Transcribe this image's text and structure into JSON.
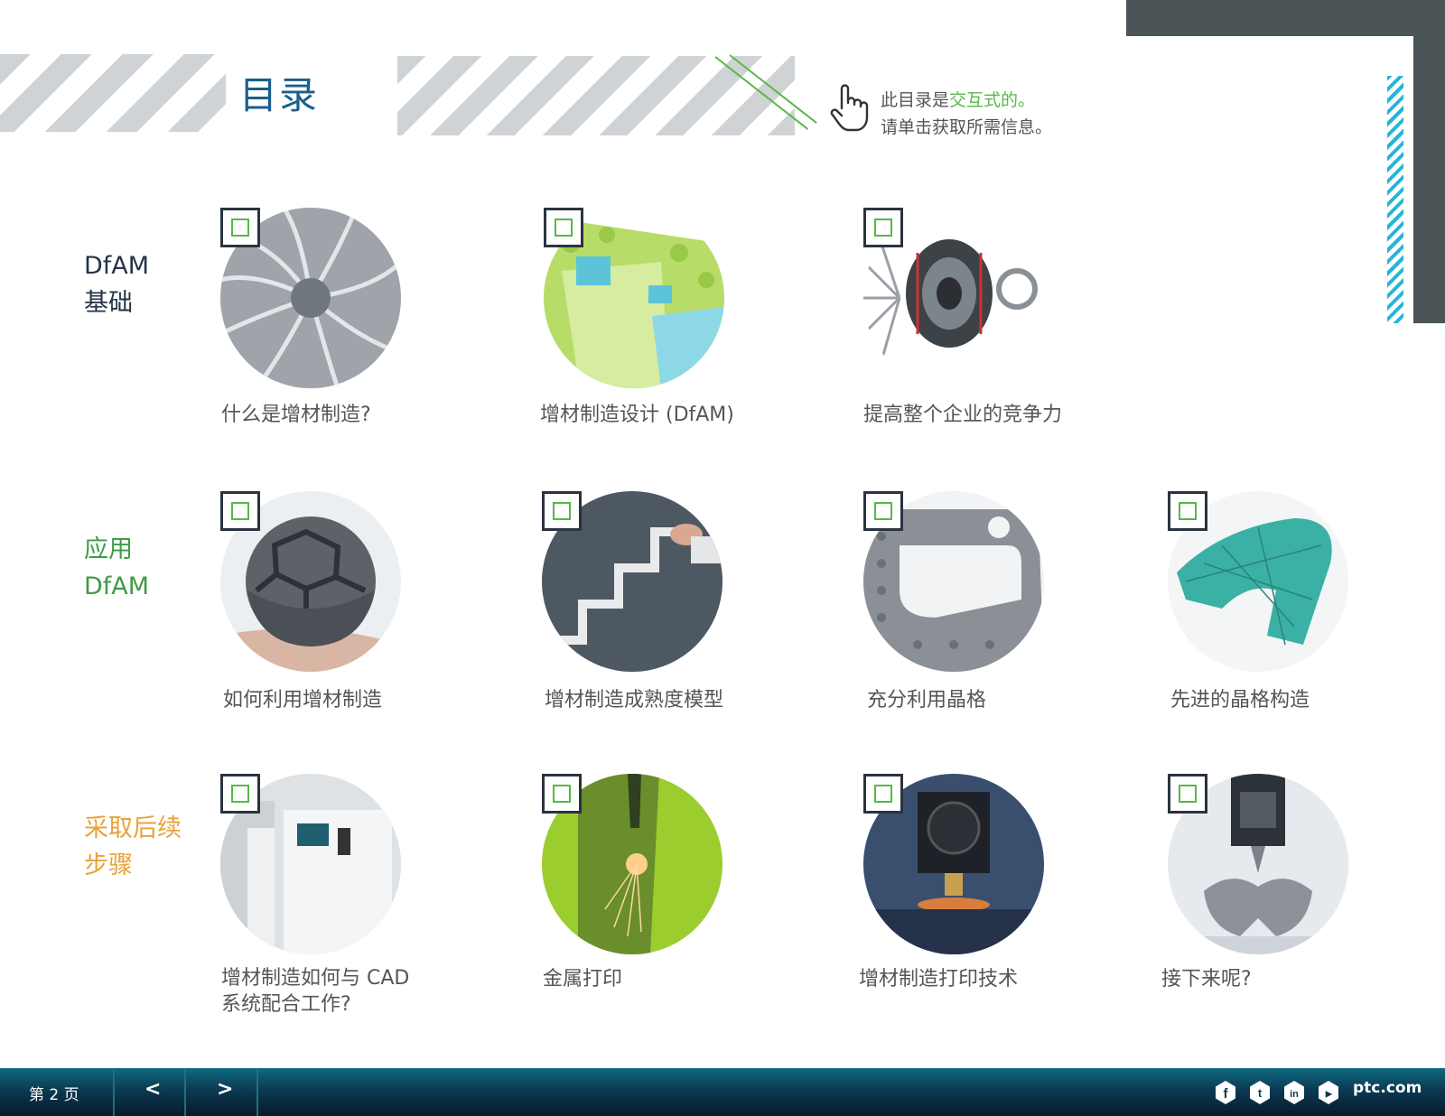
{
  "header": {
    "title": "目录",
    "hint_line1_prefix": "此目录是",
    "hint_line1_highlight": "交互式的。",
    "hint_line2": "请单击获取所需信息。",
    "hand_icon": "pointer-hand-icon"
  },
  "sections": [
    {
      "line1": "DfAM",
      "line2": "基础"
    },
    {
      "line1": "应用",
      "line2": "DfAM"
    },
    {
      "line1": "采取后续",
      "line2": "步骤"
    }
  ],
  "tiles": [
    {
      "caption": "什么是增材制造?"
    },
    {
      "caption": "增材制造设计 (DfAM)"
    },
    {
      "caption": "提高整个企业的竞争力"
    },
    {
      "caption": "如何利用增材制造"
    },
    {
      "caption": "增材制造成熟度模型"
    },
    {
      "caption": "充分利用晶格"
    },
    {
      "caption": "先进的晶格构造"
    },
    {
      "caption": "增材制造如何与 CAD"
    },
    {
      "caption": "金属打印"
    },
    {
      "caption": "增材制造打印技术"
    },
    {
      "caption": "接下来呢?"
    }
  ],
  "tile_extra": {
    "cad_line2": "系统配合工作?"
  },
  "footer": {
    "page_label": "第 2 页",
    "prev": "<",
    "next": ">",
    "site": "ptc.com",
    "icons": {
      "facebook": "f",
      "twitter": "t",
      "linkedin": "in",
      "youtube": "▶"
    }
  },
  "colors": {
    "title_blue": "#1b5e8c",
    "green": "#57b847",
    "orange": "#e9a23b",
    "dark": "#243447",
    "cyan": "#27b5d6",
    "footer": "#0b3a52"
  }
}
